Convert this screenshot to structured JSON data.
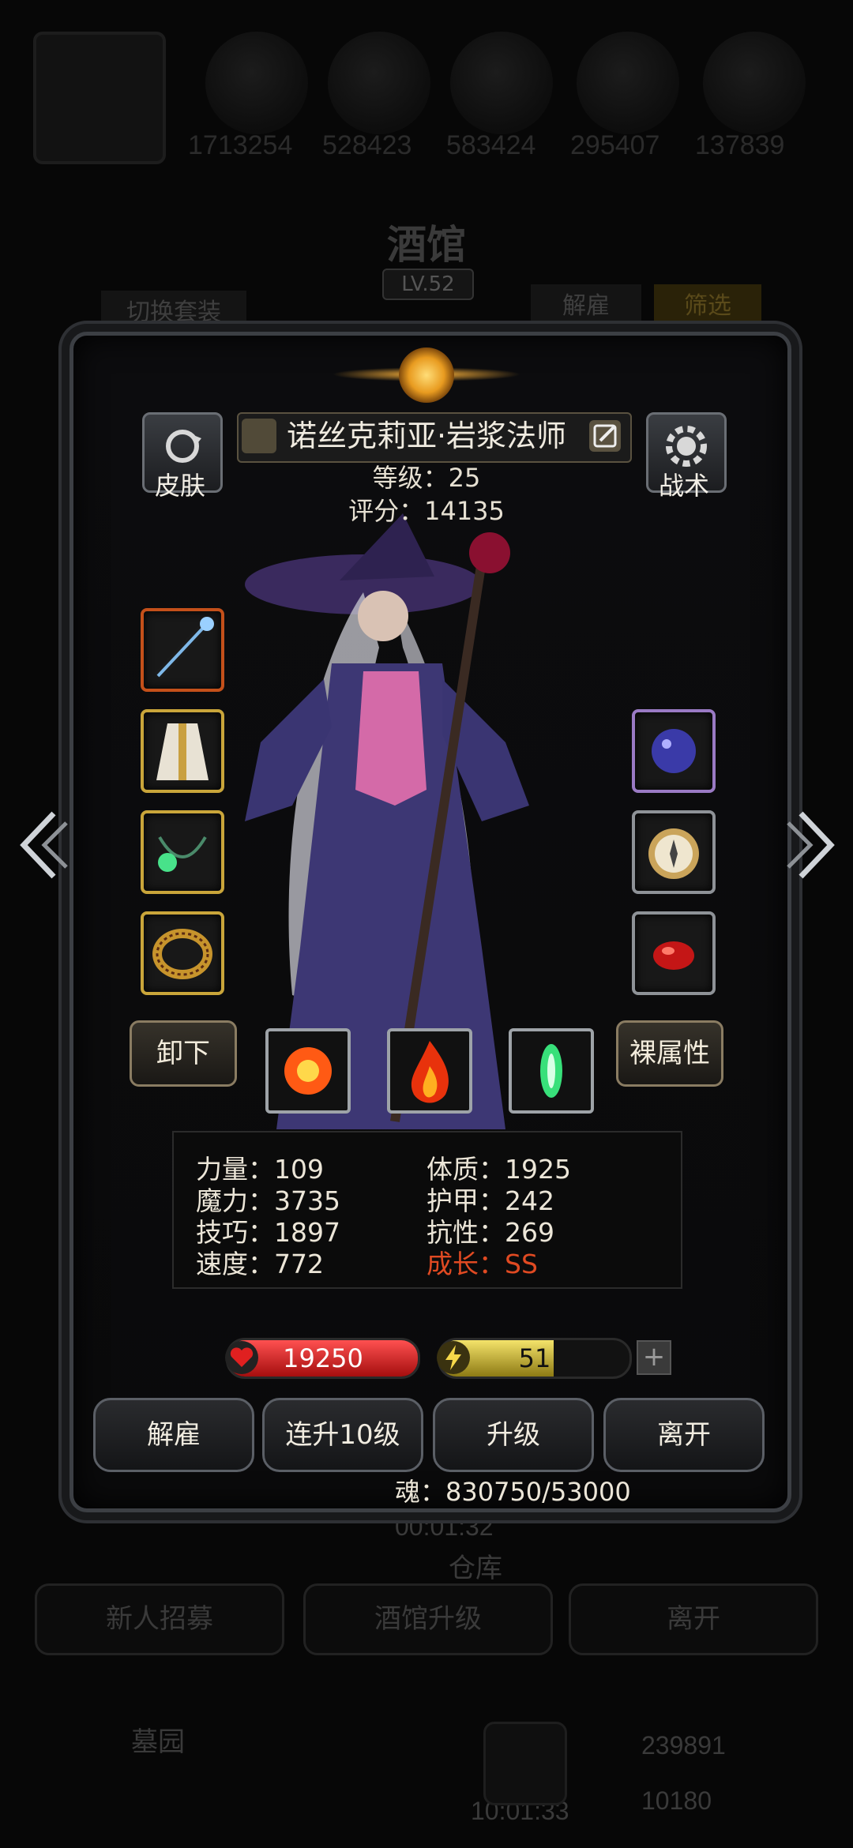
{
  "background": {
    "resources": [
      "1713254",
      "528423",
      "583424",
      "295407",
      "137839"
    ],
    "title": "酒馆",
    "level": "LV.52",
    "tabs": {
      "switch_outfit": "切换套装",
      "dismiss": "解雇",
      "filter": "筛选"
    },
    "timer": "00:01:32",
    "storage": "仓库",
    "buttons": [
      "新人招募",
      "酒馆升级",
      "离开"
    ],
    "cemetery": "墓园",
    "bottom_timer": "10:01:33",
    "bottom_resources": [
      "239891",
      "10180"
    ]
  },
  "hero": {
    "name": "诺丝克莉亚·岩浆法师",
    "level_text": "等级：25",
    "score_text": "评分：14135"
  },
  "side_buttons": {
    "skin": "皮肤",
    "tactics": "战术"
  },
  "equipment": {
    "left": [
      "staff-icon",
      "robe-icon",
      "amulet-icon",
      "ring-icon"
    ],
    "right": [
      "purple-gem-icon",
      "compass-icon",
      "red-stone-icon"
    ]
  },
  "actions": {
    "unequip": "卸下",
    "naked_attr": "裸属性"
  },
  "skills": [
    "fire-burst-icon",
    "flame-icon",
    "green-crystal-icon"
  ],
  "stats": {
    "strength": "力量：109",
    "magic": "魔力：3735",
    "skill": "技巧：1897",
    "speed": "速度：772",
    "constitution": "体质：1925",
    "armor": "护甲：242",
    "resistance": "抗性：269",
    "growth": "成长：SS"
  },
  "hp": {
    "value": "19250",
    "fill": 1.0
  },
  "energy": {
    "value": "51",
    "fill": 0.6
  },
  "plus": "+",
  "bottom_buttons": {
    "dismiss": "解雇",
    "level10": "连升10级",
    "levelup": "升级",
    "leave": "离开"
  },
  "soul": "魂：830750/53000",
  "colors": {
    "growth": "#e04a22",
    "hp": "#d41a1a",
    "energy": "#d8c232",
    "frame": "#3c3f44"
  }
}
